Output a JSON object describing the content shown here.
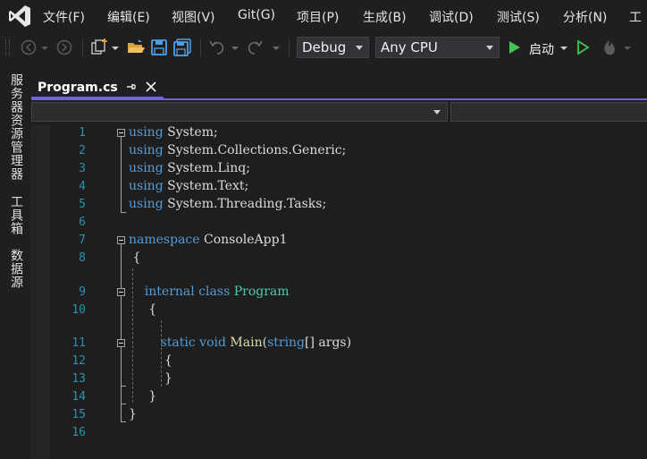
{
  "menu": {
    "items": [
      "文件(F)",
      "编辑(E)",
      "视图(V)",
      "Git(G)",
      "项目(P)",
      "生成(B)",
      "调试(D)",
      "测试(S)",
      "分析(N)",
      "工"
    ]
  },
  "toolbar": {
    "config": "Debug",
    "platform": "Any CPU",
    "start_label": "启动"
  },
  "sidebar": {
    "tabs": [
      "服务器资源管理器",
      "工具箱",
      "数据源"
    ]
  },
  "tabs": [
    {
      "title": "Program.cs",
      "active": true
    }
  ],
  "editor": {
    "lines": [
      {
        "num": "1",
        "tokens": [
          {
            "t": "using",
            "c": "kw"
          },
          {
            "t": " System;",
            "c": "plain"
          }
        ]
      },
      {
        "num": "2",
        "tokens": [
          {
            "t": "using",
            "c": "kw"
          },
          {
            "t": " System.Collections.Generic;",
            "c": "plain"
          }
        ]
      },
      {
        "num": "3",
        "tokens": [
          {
            "t": "using",
            "c": "kw"
          },
          {
            "t": " System.Linq;",
            "c": "plain"
          }
        ]
      },
      {
        "num": "4",
        "tokens": [
          {
            "t": "using",
            "c": "kw"
          },
          {
            "t": " System.Text;",
            "c": "plain"
          }
        ]
      },
      {
        "num": "5",
        "tokens": [
          {
            "t": "using",
            "c": "kw"
          },
          {
            "t": " System.Threading.Tasks;",
            "c": "plain"
          }
        ]
      },
      {
        "num": "6",
        "tokens": []
      },
      {
        "num": "7",
        "tokens": [
          {
            "t": "namespace",
            "c": "kw"
          },
          {
            "t": " ConsoleApp1",
            "c": "plain"
          }
        ]
      },
      {
        "num": "8",
        "tokens": [
          {
            "t": " {",
            "c": "plain"
          }
        ]
      },
      {
        "num": "9",
        "tokens": [
          {
            "t": "    ",
            "c": "plain"
          },
          {
            "t": "internal",
            "c": "kw"
          },
          {
            "t": " ",
            "c": "plain"
          },
          {
            "t": "class",
            "c": "kw"
          },
          {
            "t": " ",
            "c": "plain"
          },
          {
            "t": "Program",
            "c": "type"
          }
        ]
      },
      {
        "num": "10",
        "tokens": [
          {
            "t": "     {",
            "c": "plain"
          }
        ]
      },
      {
        "num": "11",
        "tokens": [
          {
            "t": "        ",
            "c": "plain"
          },
          {
            "t": "static",
            "c": "kw"
          },
          {
            "t": " ",
            "c": "plain"
          },
          {
            "t": "void",
            "c": "kw"
          },
          {
            "t": " ",
            "c": "plain"
          },
          {
            "t": "Main",
            "c": "fn"
          },
          {
            "t": "(",
            "c": "plain"
          },
          {
            "t": "string",
            "c": "kw"
          },
          {
            "t": "[] args)",
            "c": "plain"
          }
        ]
      },
      {
        "num": "12",
        "tokens": [
          {
            "t": "         {",
            "c": "plain"
          }
        ]
      },
      {
        "num": "13",
        "tokens": [
          {
            "t": "         }",
            "c": "plain"
          }
        ]
      },
      {
        "num": "14",
        "tokens": [
          {
            "t": "     }",
            "c": "plain"
          }
        ]
      },
      {
        "num": "15",
        "tokens": [
          {
            "t": "}",
            "c": "plain"
          }
        ]
      },
      {
        "num": "16",
        "tokens": []
      }
    ]
  },
  "colors": {
    "accent": "#7160e8",
    "keyword": "#569cd6",
    "type": "#4ec9b0",
    "method": "#dcdcaa",
    "line_number": "#2b91af",
    "start_green": "#3fc455"
  }
}
